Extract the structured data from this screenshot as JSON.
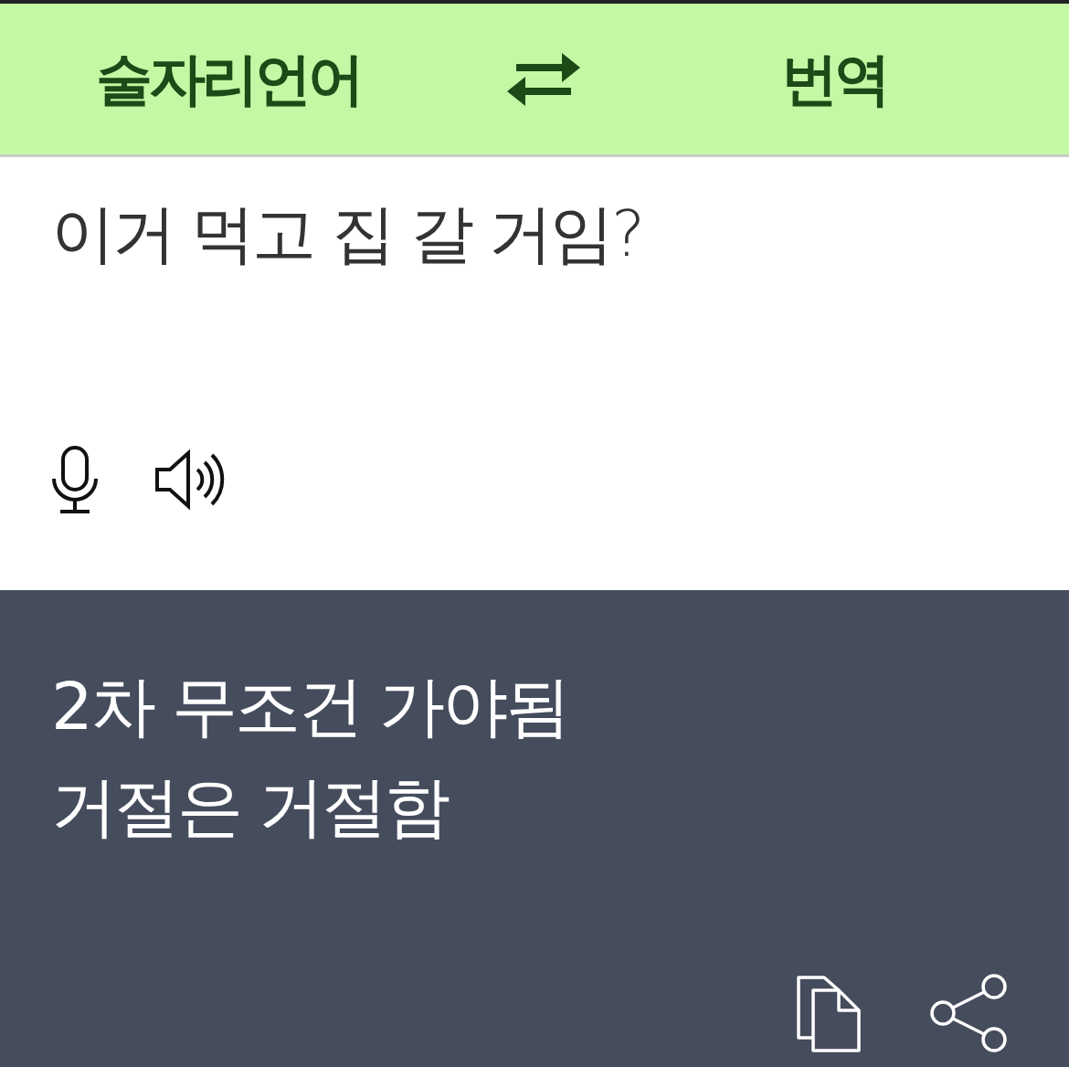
{
  "header": {
    "source_language": "술자리언어",
    "target_language": "번역"
  },
  "input": {
    "value": "이거 먹고 집 갈 거임?"
  },
  "output": {
    "lines": [
      "2차 무조건 가야됨",
      "거절은 거절함"
    ]
  }
}
